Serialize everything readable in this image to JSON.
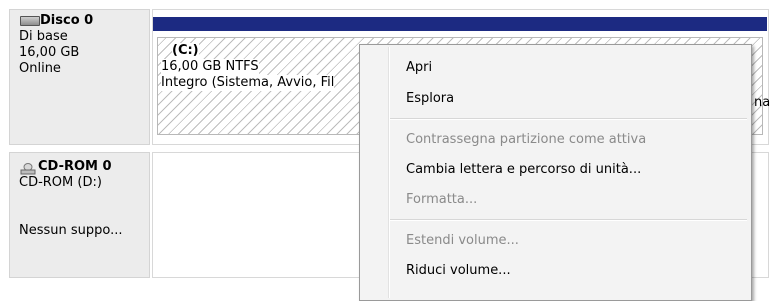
{
  "disks": [
    {
      "name": "Disco 0",
      "icon": "hard-disk-icon",
      "type": "Di base",
      "size": "16,00 GB",
      "status": "Online",
      "partition": {
        "letter": "(C:)",
        "size_fs": "16,00 GB NTFS",
        "status": "Integro (Sistema, Avvio, Fil"
      }
    },
    {
      "name": "CD-ROM 0",
      "icon": "cd-rom-icon",
      "type": "CD-ROM (D:)",
      "status": "Nessun suppo..."
    }
  ],
  "clipped_text_right": "na",
  "context_menu": {
    "items": [
      {
        "label": "Apri",
        "enabled": true
      },
      {
        "label": "Esplora",
        "enabled": true
      },
      {
        "label": "Contrassegna partizione come attiva",
        "enabled": false
      },
      {
        "label": "Cambia lettera e percorso di unità...",
        "enabled": true
      },
      {
        "label": "Formatta...",
        "enabled": false
      },
      {
        "label": "Estendi volume...",
        "enabled": false
      },
      {
        "label": "Riduci volume...",
        "enabled": true
      }
    ]
  },
  "colors": {
    "primary_partition_bar": "#1c2a82",
    "panel_bg": "#f4f4f4",
    "disabled_text": "#8a8a8a"
  }
}
